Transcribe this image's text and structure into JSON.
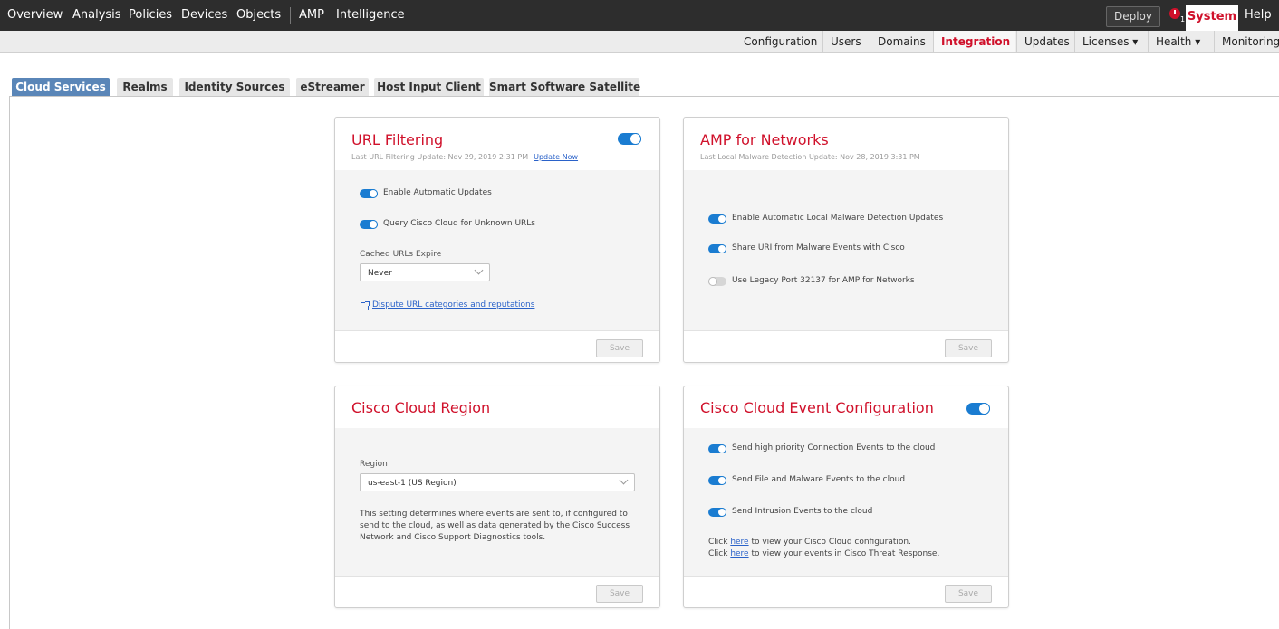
{
  "topnav": {
    "items": [
      "Overview",
      "Analysis",
      "Policies",
      "Devices",
      "Objects",
      "AMP",
      "Intelligence"
    ],
    "deploy_label": "Deploy",
    "alert_count": "1",
    "system_label": "System",
    "help_label": "Help"
  },
  "subnav": {
    "items": [
      "Configuration",
      "Users",
      "Domains",
      "Integration",
      "Updates",
      "Licenses ▾",
      "Health ▾",
      "Monitoring"
    ],
    "active": "Integration"
  },
  "tabs": {
    "items": [
      "Cloud Services",
      "Realms",
      "Identity Sources",
      "eStreamer",
      "Host Input Client",
      "Smart Software Satellite"
    ],
    "active": "Cloud Services"
  },
  "url_filtering": {
    "title": "URL Filtering",
    "enabled": true,
    "last_update": "Last URL Filtering Update: Nov 29, 2019 2:31 PM",
    "update_now": "Update Now",
    "opt_auto_updates": "Enable Automatic Updates",
    "opt_query_cloud": "Query Cisco Cloud for Unknown URLs",
    "cached_label": "Cached URLs Expire",
    "cached_value": "Never",
    "dispute_link": "Dispute URL categories and reputations",
    "save_label": "Save"
  },
  "amp": {
    "title": "AMP for Networks",
    "last_update": "Last Local Malware Detection Update: Nov 28, 2019 3:31 PM",
    "opt_local_updates": "Enable Automatic Local Malware Detection Updates",
    "opt_share_uri": "Share URI from Malware Events with Cisco",
    "opt_legacy_port": "Use Legacy Port 32137 for AMP for Networks",
    "save_label": "Save"
  },
  "region": {
    "title": "Cisco Cloud Region",
    "region_label": "Region",
    "region_value": "us-east-1 (US Region)",
    "description": "This setting determines where events are sent to, if configured to send to the cloud, as well as data generated by the Cisco Success Network and Cisco Support Diagnostics tools.",
    "save_label": "Save"
  },
  "event_config": {
    "title": "Cisco Cloud Event Configuration",
    "enabled": true,
    "opt_connection": "Send high priority Connection Events to the cloud",
    "opt_file": "Send File and Malware Events to the cloud",
    "opt_intrusion": "Send Intrusion Events to the cloud",
    "click_prefix": "Click ",
    "here": "here",
    "line1_suffix": " to view your Cisco Cloud configuration.",
    "line2_suffix": " to view your events in Cisco Threat Response.",
    "save_label": "Save"
  },
  "colors": {
    "accent_red": "#d0112b",
    "toggle_blue": "#1a7cd1",
    "active_tab": "#5a86b8"
  }
}
